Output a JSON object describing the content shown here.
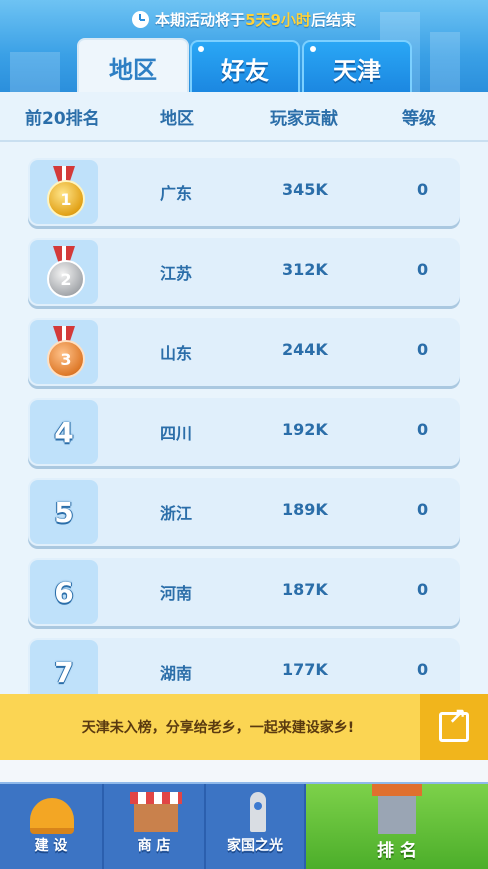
{
  "notice": {
    "prefix": "本期活动将于",
    "highlight": "5天9小时",
    "suffix": "后结束"
  },
  "tabs": [
    {
      "label": "地区",
      "active": true
    },
    {
      "label": "好友",
      "active": false
    },
    {
      "label": "天津",
      "active": false
    }
  ],
  "columns": {
    "rank": "前20排名",
    "region": "地区",
    "contribution": "玩家贡献",
    "level": "等级"
  },
  "rows": [
    {
      "rank": "1",
      "region": "广东",
      "contribution": "345K",
      "level": "0"
    },
    {
      "rank": "2",
      "region": "江苏",
      "contribution": "312K",
      "level": "0"
    },
    {
      "rank": "3",
      "region": "山东",
      "contribution": "244K",
      "level": "0"
    },
    {
      "rank": "4",
      "region": "四川",
      "contribution": "192K",
      "level": "0"
    },
    {
      "rank": "5",
      "region": "浙江",
      "contribution": "189K",
      "level": "0"
    },
    {
      "rank": "6",
      "region": "河南",
      "contribution": "187K",
      "level": "0"
    },
    {
      "rank": "7",
      "region": "湖南",
      "contribution": "177K",
      "level": "0"
    }
  ],
  "banner": {
    "text": "天津未入榜，分享给老乡，一起来建设家乡!"
  },
  "bottom_nav": [
    {
      "label": "建 设",
      "icon": "helmet-icon",
      "active": false
    },
    {
      "label": "商 店",
      "icon": "shop-icon",
      "active": false
    },
    {
      "label": "家国之光",
      "icon": "rocket-icon",
      "active": false
    },
    {
      "label": "排 名",
      "icon": "ranking-building-icon",
      "active": true
    }
  ],
  "colors": {
    "accent": "#2b6ea9",
    "tab_blue": "#1b86e0",
    "banner": "#fbd553",
    "nav_active": "#4cae2a"
  }
}
